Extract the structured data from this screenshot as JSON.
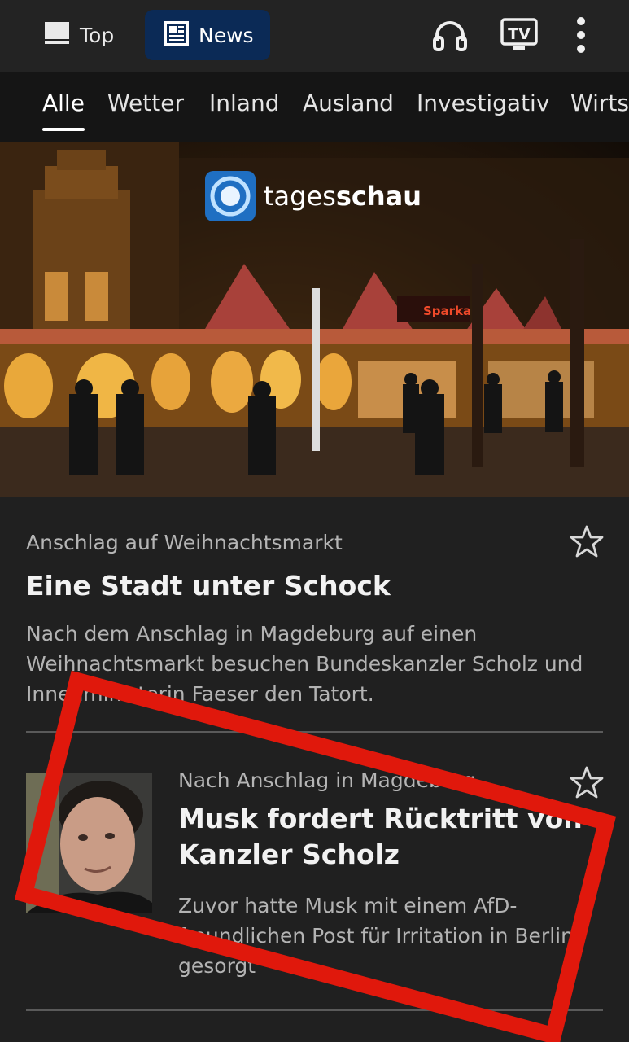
{
  "topbar": {
    "tabs": [
      {
        "label": "Top",
        "icon": "laptop-icon",
        "selected": false
      },
      {
        "label": "News",
        "icon": "news-icon",
        "selected": true
      }
    ],
    "actions": [
      "headphones-icon",
      "tv-icon",
      "more-vertical-icon"
    ],
    "tv_icon_text": "TV"
  },
  "categories": {
    "items": [
      "Alle",
      "Wetter",
      "Inland",
      "Ausland",
      "Investigativ",
      "Wirts"
    ],
    "selected": "Alle"
  },
  "hero": {
    "brand_prefix": "tages",
    "brand_suffix": "schau",
    "sign_text": "Sparka"
  },
  "articles": [
    {
      "kicker": "Anschlag auf Weihnachtsmarkt",
      "headline": "Eine Stadt unter Schock",
      "teaser_lines": [
        "Nach dem Anschlag in Magdeburg auf einen",
        "Weihnachtsmarkt besuchen Bundeskanzler Scholz und",
        "Innenministerin Faeser den Tatort."
      ]
    },
    {
      "kicker": "Nach Anschlag in Magdeburg",
      "headline_lines": [
        "Musk fordert Rücktritt von",
        "Kanzler Scholz"
      ],
      "teaser_lines": [
        "Zuvor hatte Musk mit einem AfD-",
        "freundlichen Post für Irritation in Berlin",
        "gesorgt"
      ]
    }
  ],
  "colors": {
    "background": "#202020",
    "news_tab_bg": "#0b2a56",
    "annotation_red": "#e0180c",
    "tagesschau_blue": "#1f6fc2"
  }
}
